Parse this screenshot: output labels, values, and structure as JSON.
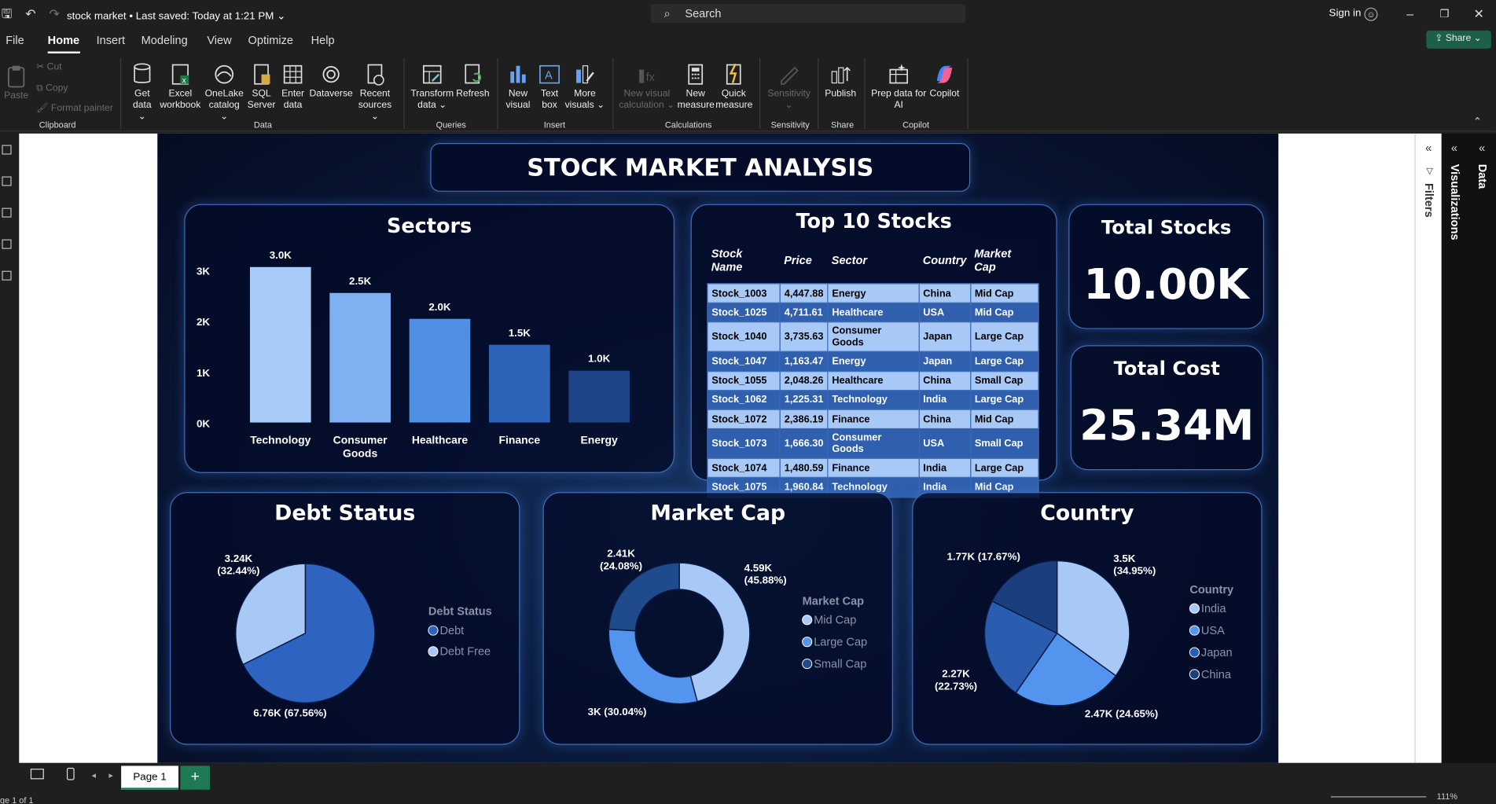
{
  "window": {
    "title": "stock market",
    "saved": "Last saved: Today at 1:21 PM",
    "search_placeholder": "Search",
    "signin": "Sign in"
  },
  "menu": {
    "items": [
      "File",
      "Home",
      "Insert",
      "Modeling",
      "View",
      "Optimize",
      "Help"
    ],
    "active": "Home",
    "share": "Share"
  },
  "ribbon": {
    "clipboard": {
      "paste": "Paste",
      "cut": "Cut",
      "copy": "Copy",
      "format_painter": "Format painter",
      "group": "Clipboard"
    },
    "data": {
      "get_data": "Get data",
      "excel": "Excel workbook",
      "onelake": "OneLake catalog",
      "sql": "SQL Server",
      "enter": "Enter data",
      "dataverse": "Dataverse",
      "recent": "Recent sources",
      "group": "Data"
    },
    "queries": {
      "transform": "Transform data",
      "refresh": "Refresh",
      "group": "Queries"
    },
    "insert": {
      "new_visual": "New visual",
      "text_box": "Text box",
      "more_visuals": "More visuals",
      "group": "Insert"
    },
    "calculations": {
      "new_visual_calc": "New visual calculation",
      "new_measure": "New measure",
      "quick_measure": "Quick measure",
      "group": "Calculations"
    },
    "sensitivity": {
      "label": "Sensitivity",
      "group": "Sensitivity"
    },
    "share": {
      "publish": "Publish",
      "group": "Share"
    },
    "copilot": {
      "prep": "Prep data for AI",
      "copilot": "Copilot",
      "group": "Copilot"
    }
  },
  "report": {
    "title": "STOCK MARKET ANALYSIS",
    "sectors_title": "Sectors",
    "top10_title": "Top 10 Stocks",
    "total_stocks": {
      "label": "Total Stocks",
      "value": "10.00K"
    },
    "total_cost": {
      "label": "Total Cost",
      "value": "25.34M"
    },
    "debt_title": "Debt Status",
    "marketcap_title": "Market Cap",
    "country_title": "Country"
  },
  "table": {
    "headers": [
      "Stock Name",
      "Price",
      "Sector",
      "Country",
      "Market Cap"
    ],
    "rows": [
      [
        "Stock_1003",
        "4,447.88",
        "Energy",
        "China",
        "Mid Cap"
      ],
      [
        "Stock_1025",
        "4,711.61",
        "Healthcare",
        "USA",
        "Mid Cap"
      ],
      [
        "Stock_1040",
        "3,735.63",
        "Consumer Goods",
        "Japan",
        "Large Cap"
      ],
      [
        "Stock_1047",
        "1,163.47",
        "Energy",
        "Japan",
        "Large Cap"
      ],
      [
        "Stock_1055",
        "2,048.26",
        "Healthcare",
        "China",
        "Small Cap"
      ],
      [
        "Stock_1062",
        "1,225.31",
        "Technology",
        "India",
        "Large Cap"
      ],
      [
        "Stock_1072",
        "2,386.19",
        "Finance",
        "China",
        "Mid Cap"
      ],
      [
        "Stock_1073",
        "1,666.30",
        "Consumer Goods",
        "USA",
        "Small Cap"
      ],
      [
        "Stock_1074",
        "1,480.59",
        "Finance",
        "India",
        "Large Cap"
      ],
      [
        "Stock_1075",
        "1,960.84",
        "Technology",
        "India",
        "Mid Cap"
      ]
    ]
  },
  "chart_data": [
    {
      "type": "bar",
      "title": "Sectors",
      "categories": [
        "Technology",
        "Consumer Goods",
        "Healthcare",
        "Finance",
        "Energy"
      ],
      "values": [
        3000,
        2500,
        2000,
        1500,
        1000
      ],
      "data_labels": [
        "3.0K",
        "2.5K",
        "2.0K",
        "1.5K",
        "1.0K"
      ],
      "yticks": [
        "0K",
        "1K",
        "2K",
        "3K"
      ],
      "ylim": [
        0,
        3000
      ],
      "colors": [
        "#a9cbf7",
        "#7fb0f2",
        "#4f8fe6",
        "#2d63b8",
        "#1d4587"
      ]
    },
    {
      "type": "pie",
      "title": "Debt Status",
      "legend_title": "Debt Status",
      "labels": [
        "Debt",
        "Debt Free"
      ],
      "values": [
        6760,
        3240
      ],
      "data_labels": [
        "6.76K (67.56%)",
        "3.24K (32.44%)"
      ],
      "colors": [
        "#2e64bf",
        "#a8c8f5"
      ]
    },
    {
      "type": "pie",
      "variant": "donut",
      "title": "Market Cap",
      "legend_title": "Market Cap",
      "labels": [
        "Mid Cap",
        "Large Cap",
        "Small Cap"
      ],
      "values": [
        4590,
        3000,
        2410
      ],
      "data_labels": [
        "4.59K (45.88%)",
        "3K (30.04%)",
        "2.41K (24.08%)"
      ],
      "colors": [
        "#a8c8f5",
        "#5294ee",
        "#1f4a8c"
      ]
    },
    {
      "type": "pie",
      "title": "Country",
      "legend_title": "Country",
      "labels": [
        "India",
        "USA",
        "Japan",
        "China"
      ],
      "values": [
        3500,
        2470,
        2270,
        1770
      ],
      "data_labels": [
        "3.5K (34.95%)",
        "2.47K (24.65%)",
        "2.27K (22.73%)",
        "1.77K (17.67%)"
      ],
      "colors": [
        "#a8c8f5",
        "#5294ee",
        "#2a5cb0",
        "#1b3f7e"
      ]
    }
  ],
  "panes": {
    "filters": "Filters",
    "visualizations": "Visualizations",
    "data": "Data"
  },
  "status": {
    "page_tab": "Page 1",
    "page_info": "ge 1 of 1",
    "zoom": "111%"
  }
}
